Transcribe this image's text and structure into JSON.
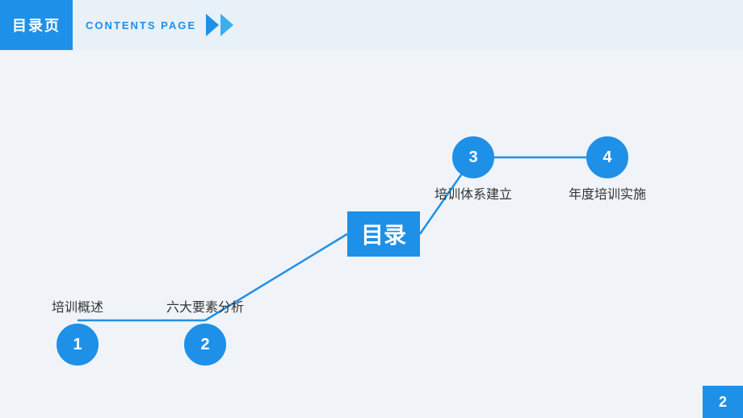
{
  "header": {
    "cn_title": "目录页",
    "en_title": "CONTENTS PAGE"
  },
  "page_number": "2",
  "timeline": {
    "center_label": "目录",
    "items": [
      {
        "id": "1",
        "label": "培训概述"
      },
      {
        "id": "2",
        "label": "六大要素分析"
      },
      {
        "id": "3",
        "label": "培训体系建立"
      },
      {
        "id": "4",
        "label": "年度培训实施"
      }
    ]
  },
  "colors": {
    "blue": "#1e90e8",
    "light_blue": "#3aaff0",
    "bg": "#f0f4f8",
    "header_bg": "#e8f0f8"
  }
}
